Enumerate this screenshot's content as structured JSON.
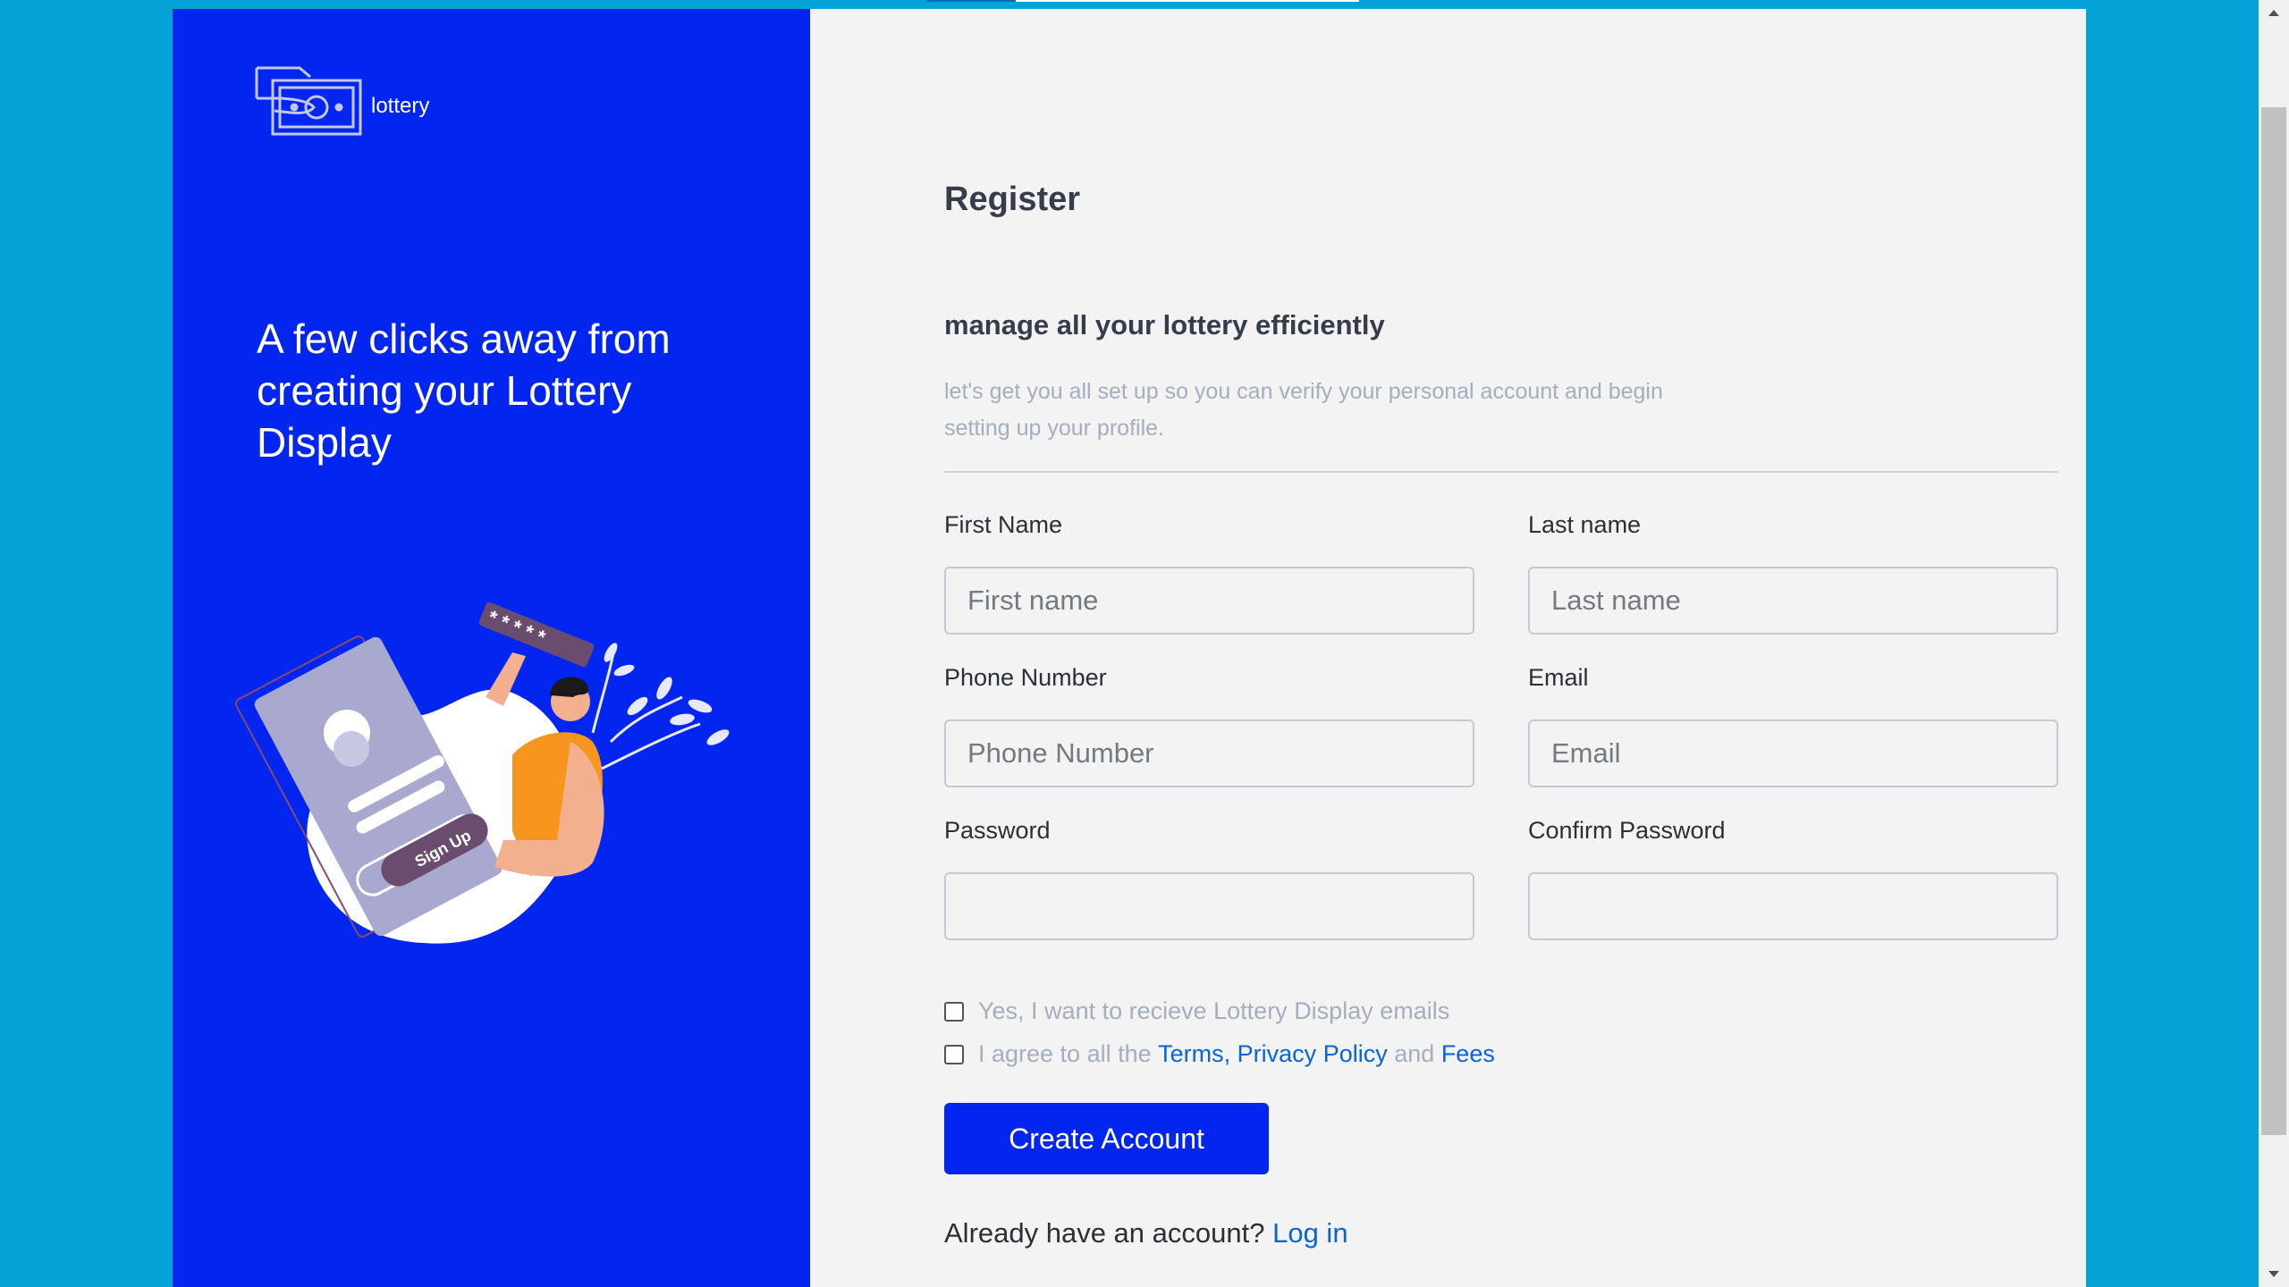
{
  "brand": {
    "logo_text": "lottery",
    "logo_icon": "money-hand-icon"
  },
  "hero": {
    "tagline": "A few clicks away from creating your Lottery Display"
  },
  "illustration": {
    "sign_up_label": "Sign Up",
    "password_stars": "*****"
  },
  "form": {
    "title": "Register",
    "subtitle": "manage all your lottery efficiently",
    "description": "let's get you all set up so you can verify your personal account and begin setting up your profile.",
    "fields": {
      "first_name": {
        "label": "First Name",
        "placeholder": "First name",
        "value": ""
      },
      "last_name": {
        "label": "Last name",
        "placeholder": "Last name",
        "value": ""
      },
      "phone": {
        "label": "Phone Number",
        "placeholder": "Phone Number",
        "value": ""
      },
      "email": {
        "label": "Email",
        "placeholder": "Email",
        "value": ""
      },
      "password": {
        "label": "Password",
        "placeholder": "",
        "value": ""
      },
      "confirm_password": {
        "label": "Confirm Password",
        "placeholder": "",
        "value": ""
      }
    },
    "checkboxes": {
      "emails": {
        "label": "Yes, I want to recieve Lottery Display emails",
        "checked": false
      },
      "terms": {
        "prefix": "I agree to all the",
        "terms_link": "Terms,",
        "privacy_link": "Privacy Policy",
        "joiner": "and",
        "fees_link": "Fees",
        "checked": false
      }
    },
    "submit_label": "Create Account",
    "signin_prompt": "Already have an account?",
    "signin_link": "Log in"
  },
  "colors": {
    "page_background": "#04a2d6",
    "panel_blue": "#0325f0",
    "form_background": "#f2f3f2",
    "link": "#0a63d8",
    "muted_text": "#a4aebd"
  }
}
